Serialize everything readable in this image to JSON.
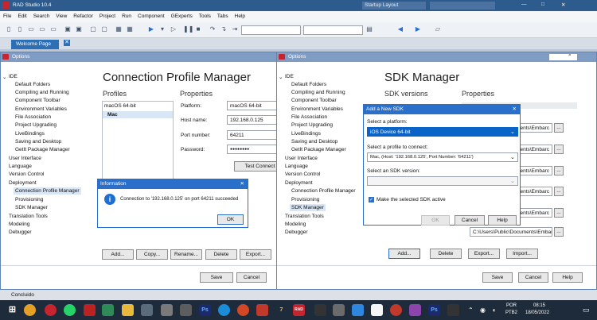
{
  "ide": {
    "title": "RAD Studio 10.4",
    "layout": "Startup Layout",
    "menu": [
      "File",
      "Edit",
      "Search",
      "View",
      "Refactor",
      "Project",
      "Run",
      "Component",
      "GExperts",
      "Tools",
      "Tabs",
      "Help"
    ],
    "tab": "Welcome Page"
  },
  "opt1": {
    "title": "Options",
    "tree": [
      "IDE",
      "Default Folders",
      "Compiling and Running",
      "Component Toolbar",
      "Environment Variables",
      "File Association",
      "Project Upgrading",
      "LiveBindings",
      "Saving and Desktop",
      "GetIt Package Manager",
      "User Interface",
      "Language",
      "Version Control",
      "Deployment",
      "Connection Profile Manager",
      "Provisioning",
      "SDK Manager",
      "Translation Tools",
      "Modeling",
      "Debugger"
    ],
    "heading": "Connection Profile Manager",
    "profiles_label": "Profiles",
    "properties_label": "Properties",
    "profiles": [
      "macOS 64-bit",
      "Mac"
    ],
    "platform_label": "Platform:",
    "platform": "macOS 64-bit",
    "host_label": "Host name:",
    "host": "192.168.0.125",
    "port_label": "Port number:",
    "port": "64211",
    "password_label": "Password:",
    "password": "●●●●●●●●",
    "test": "Test Connect",
    "add": "Add...",
    "copy": "Copy...",
    "rename": "Rename...",
    "delete": "Delete",
    "export": "Export...",
    "save": "Save",
    "cancel": "Cancel"
  },
  "info": {
    "title": "Information",
    "message": "Connection to '192.168.0.125' on port 64211 succeeded",
    "ok": "OK"
  },
  "opt2": {
    "title": "Options",
    "heading": "SDK Manager",
    "sdk_label": "SDK versions",
    "properties_label": "Properties",
    "paths": [
      "ments\\Embarc",
      "ments\\Embarc",
      "ments\\Embarc",
      "ments\\Embarc",
      "ments\\Embarc",
      "C:\\Users\\Public\\Documents\\Embarc"
    ],
    "more": "...",
    "add": "Add...",
    "delete": "Delete",
    "export": "Export...",
    "import": "Import...",
    "save": "Save",
    "cancel": "Cancel",
    "help": "Help"
  },
  "sdk": {
    "title": "Add a New SDK",
    "platform_label": "Select a platform:",
    "platform": "iOS Device 64-bit",
    "profile_label": "Select a profile to connect:",
    "profile": "Mac, (Host: '192.168.0.125', Port Number: '64211')",
    "version_label": "Select an SDK version:",
    "active": "Make the selected SDK active",
    "ok": "OK",
    "cancel": "Cancel",
    "help": "Help"
  },
  "status": "Concluido",
  "taskbar": {
    "lang": "POR",
    "kb": "PTB2",
    "time": "08:15",
    "date": "18/05/2022"
  },
  "colors": {
    "title": "#2d5b8e",
    "select": "#0a64c8",
    "dlg": "#7f9cc4"
  }
}
